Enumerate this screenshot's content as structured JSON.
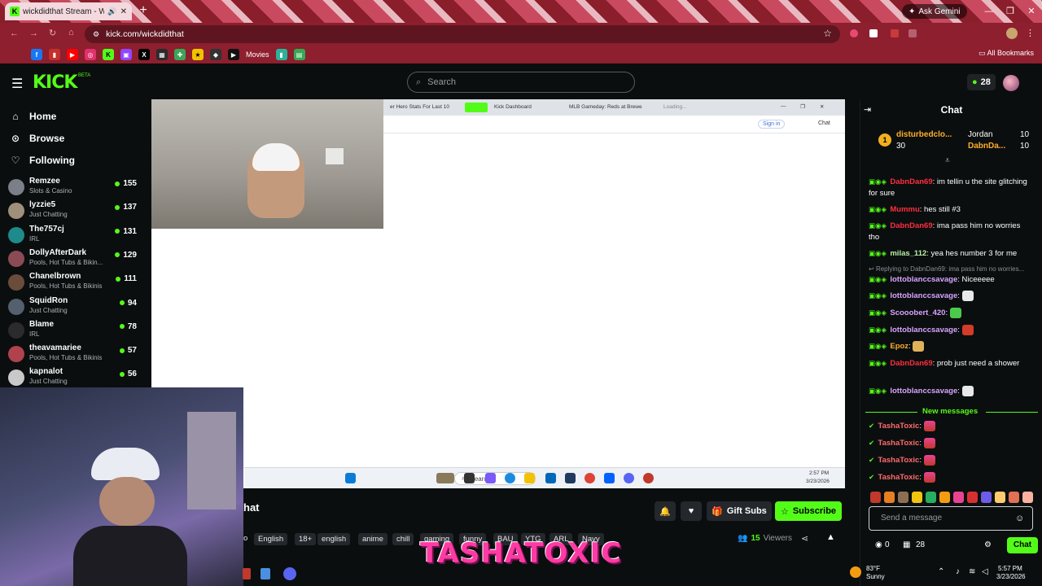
{
  "browser": {
    "active_tab_title": "wickdidthat Stream - Watc",
    "url": "kick.com/wickdidthat",
    "ask_gemini": "Ask Gemini",
    "bookmarks_movies": "Movies",
    "all_bookmarks": "All Bookmarks"
  },
  "header": {
    "logo": "KICK",
    "logo_beta": "BETA",
    "search_placeholder": "Search",
    "kicks_count": "28"
  },
  "sidebar": {
    "nav": [
      {
        "label": "Home",
        "icon": "home-icon"
      },
      {
        "label": "Browse",
        "icon": "compass-icon"
      },
      {
        "label": "Following",
        "icon": "heart-icon"
      }
    ],
    "channels": [
      {
        "name": "Remzee",
        "category": "Slots & Casino",
        "viewers": "155",
        "color": "#7b7f8a"
      },
      {
        "name": "lyzzie5",
        "category": "Just Chatting",
        "viewers": "137",
        "color": "#a08f7a"
      },
      {
        "name": "The757cj",
        "category": "IRL",
        "viewers": "131",
        "color": "#1f8a8a"
      },
      {
        "name": "DollyAfterDark",
        "category": "Pools, Hot Tubs & Bikin...",
        "viewers": "129",
        "color": "#8a4b55"
      },
      {
        "name": "Chanelbrown",
        "category": "Pools, Hot Tubs & Bikinis",
        "viewers": "111",
        "color": "#6b4c3b"
      },
      {
        "name": "SquidRon",
        "category": "Just Chatting",
        "viewers": "94",
        "color": "#55606e"
      },
      {
        "name": "Blame",
        "category": "IRL",
        "viewers": "78",
        "color": "#2b2b2b"
      },
      {
        "name": "theavamariee",
        "category": "Pools, Hot Tubs & Bikinis",
        "viewers": "57",
        "color": "#b0424e"
      },
      {
        "name": "kapnalot",
        "category": "Just Chatting",
        "viewers": "56",
        "color": "#c9c9c9"
      }
    ]
  },
  "stream": {
    "inner_tabs": [
      "er Hero Stats For Last 10",
      "Kick Dashboard",
      "MLB Gameday: Reds at Brewe",
      "Loading..."
    ],
    "inner_signin": "Sign in",
    "inner_chat": "Chat",
    "taskbar_search": "Search",
    "taskbar_time": "2:57 PM",
    "taskbar_date": "3/23/2026",
    "title_fragment": "hat",
    "tags_prefix": "o",
    "tags": [
      "English",
      "18+",
      "english",
      "anime",
      "chill",
      "gaming",
      "funny",
      "BAU",
      "YTG",
      "ARL",
      "Navy"
    ],
    "bell_icon": "bell-icon",
    "gift_subs": "Gift Subs",
    "subscribe": "Subscribe",
    "viewers_count": "15",
    "viewers_label": "Viewers",
    "watermark": "TASHATOXIC"
  },
  "chat": {
    "title": "Chat",
    "top_gifters": [
      {
        "name": "disturbedclo...",
        "count": "30",
        "rank": "1"
      },
      {
        "name": "Jordan",
        "count": "10"
      },
      {
        "name": "DabnDa...",
        "count": "10"
      }
    ],
    "messages": [
      {
        "user": "DabnDan69",
        "text": ": im tellin u the site glitching for sure",
        "cls": "u-mod"
      },
      {
        "user": "Mummu",
        "text": ": hes still #3",
        "cls": "u-mod"
      },
      {
        "user": "DabnDan69",
        "text": ": ima pass him no worries tho",
        "cls": "u-mod"
      },
      {
        "user": "milas_112",
        "text": ": yea hes number 3 for me",
        "cls": "u-green"
      },
      {
        "user": "Replying to DabnDan69: ima pass him no worries...",
        "text": "",
        "cls": "reply"
      },
      {
        "user": "lottoblanccsavage",
        "text": ": Niceeeee",
        "cls": "u-purple"
      },
      {
        "user": "lottoblanccsavage",
        "text": ":",
        "cls": "u-purple",
        "emote": "#e8e8e8"
      },
      {
        "user": "Scooobert_420",
        "text": ":",
        "cls": "u-purple",
        "emote": "#4bc94b"
      },
      {
        "user": "lottoblanccsavage",
        "text": ":",
        "cls": "u-purple",
        "emote": "#d43b2a"
      },
      {
        "user": "Epoz",
        "text": ":",
        "cls": "u-orange",
        "emote": "#e0b35a"
      },
      {
        "user": "DabnDan69",
        "text": ": prob just need a shower",
        "cls": "u-mod"
      },
      {
        "user": "lottoblanccsavage",
        "text": ":",
        "cls": "u-purple",
        "emote": "#e8e8e8"
      }
    ],
    "new_messages": "New messages",
    "new_lines": [
      {
        "user": "TashaToxic",
        "text": ":"
      },
      {
        "user": "TashaToxic",
        "text": ":"
      },
      {
        "user": "TashaToxic",
        "text": ":"
      },
      {
        "user": "TashaToxic",
        "text": ":"
      }
    ],
    "input_placeholder": "Send a message",
    "footer_left": "0",
    "footer_mid": "28",
    "send_label": "Chat"
  },
  "tray": {
    "weather_temp": "83°F",
    "weather_desc": "Sunny",
    "time": "5:57 PM",
    "date": "3/23/2026"
  },
  "colors": {
    "kick_green": "#53fc18",
    "mod_red": "#ff2e3e",
    "watermark_pink": "#ff3aa4"
  }
}
